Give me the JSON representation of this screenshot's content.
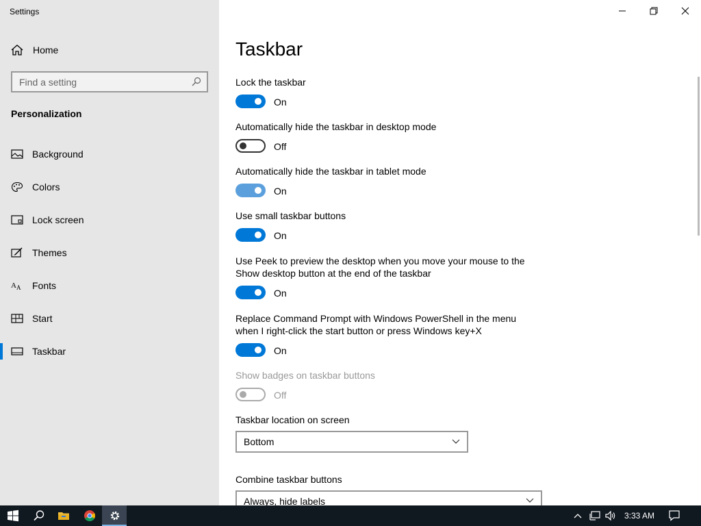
{
  "window": {
    "app_title": "Settings"
  },
  "sidebar": {
    "home_label": "Home",
    "search_placeholder": "Find a setting",
    "section_title": "Personalization",
    "items": [
      {
        "label": "Background",
        "icon": "picture-icon"
      },
      {
        "label": "Colors",
        "icon": "palette-icon"
      },
      {
        "label": "Lock screen",
        "icon": "lock-screen-icon"
      },
      {
        "label": "Themes",
        "icon": "brush-icon"
      },
      {
        "label": "Fonts",
        "icon": "font-icon"
      },
      {
        "label": "Start",
        "icon": "start-tiles-icon"
      },
      {
        "label": "Taskbar",
        "icon": "taskbar-icon",
        "selected": true
      }
    ]
  },
  "main": {
    "title": "Taskbar",
    "settings": [
      {
        "label": "Lock the taskbar",
        "state": "On"
      },
      {
        "label": "Automatically hide the taskbar in desktop mode",
        "state": "Off"
      },
      {
        "label": "Automatically hide the taskbar in tablet mode",
        "state": "On"
      },
      {
        "label": "Use small taskbar buttons",
        "state": "On"
      },
      {
        "label": "Use Peek to preview the desktop when you move your mouse to the Show desktop button at the end of the taskbar",
        "state": "On"
      },
      {
        "label": "Replace Command Prompt with Windows PowerShell in the menu when I right-click the start button or press Windows key+X",
        "state": "On"
      },
      {
        "label": "Show badges on taskbar buttons",
        "state": "Off",
        "disabled": true
      }
    ],
    "location": {
      "label": "Taskbar location on screen",
      "value": "Bottom"
    },
    "combine": {
      "label": "Combine taskbar buttons",
      "value": "Always, hide labels"
    }
  },
  "taskbar": {
    "time": "3:33 AM",
    "accent": "#0078d7"
  }
}
